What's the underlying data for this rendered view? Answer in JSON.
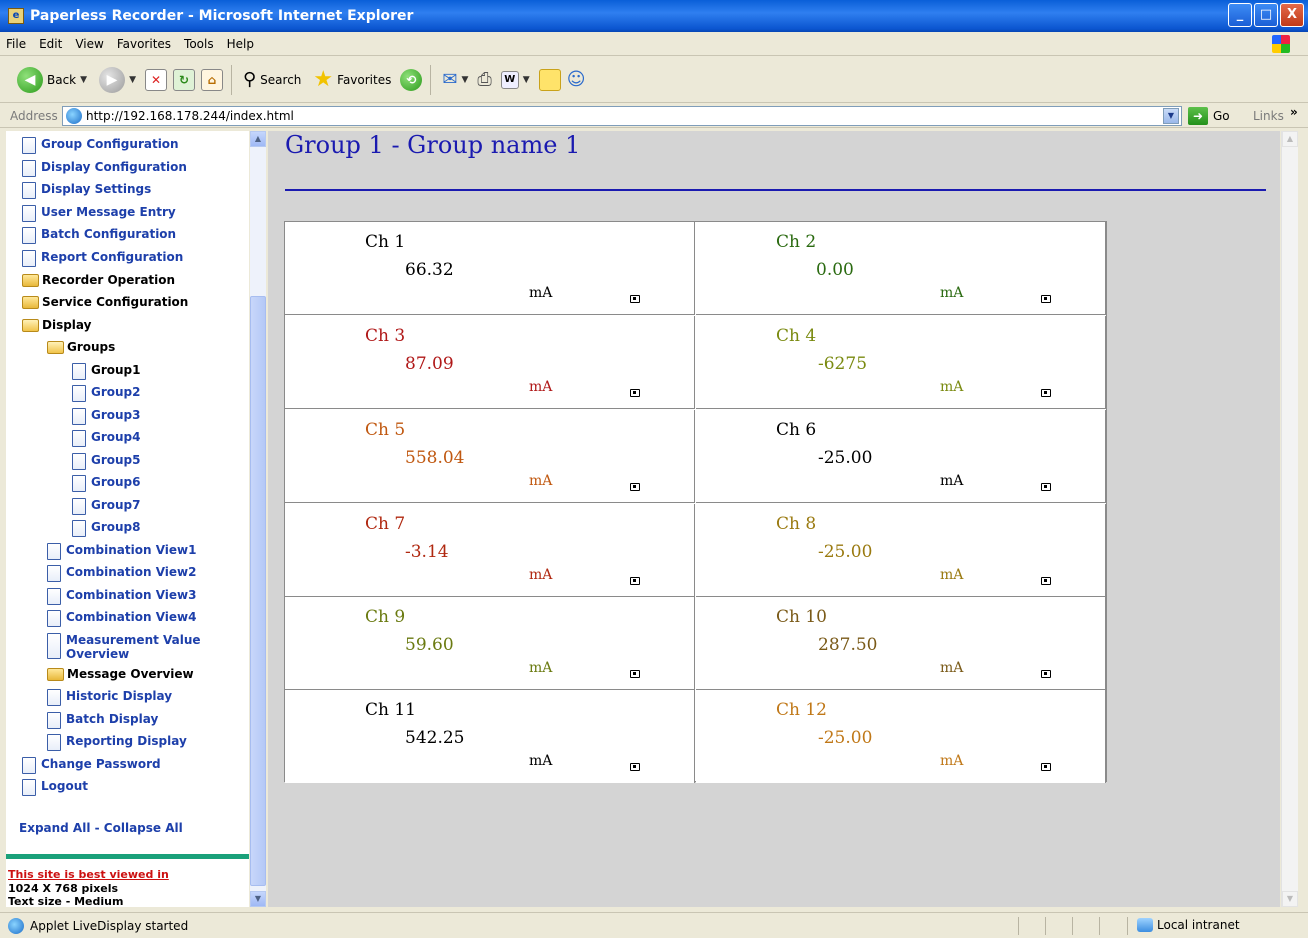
{
  "window": {
    "title": "Paperless Recorder - Microsoft Internet Explorer",
    "buttons": [
      "_",
      "□",
      "X"
    ]
  },
  "menu": [
    "File",
    "Edit",
    "View",
    "Favorites",
    "Tools",
    "Help"
  ],
  "toolbar": {
    "back_label": "Back",
    "search_label": "Search",
    "favorites_label": "Favorites"
  },
  "address": {
    "label": "Address",
    "url": "http://192.168.178.244/index.html",
    "go_label": "Go",
    "links_label": "Links"
  },
  "nav": {
    "items": [
      {
        "label": "Group Configuration",
        "type": "doc"
      },
      {
        "label": "Display Configuration",
        "type": "doc"
      },
      {
        "label": "Display Settings",
        "type": "doc"
      },
      {
        "label": "User Message Entry",
        "type": "doc"
      },
      {
        "label": "Batch Configuration",
        "type": "doc"
      },
      {
        "label": "Report Configuration",
        "type": "doc"
      },
      {
        "label": "Recorder Operation",
        "type": "folder"
      },
      {
        "label": "Service Configuration",
        "type": "folder"
      },
      {
        "label": "Display",
        "type": "folder-open"
      },
      {
        "label": "Groups",
        "type": "folder-open"
      },
      {
        "label": "Group1",
        "type": "doc"
      },
      {
        "label": "Group2",
        "type": "doc"
      },
      {
        "label": "Group3",
        "type": "doc"
      },
      {
        "label": "Group4",
        "type": "doc"
      },
      {
        "label": "Group5",
        "type": "doc"
      },
      {
        "label": "Group6",
        "type": "doc"
      },
      {
        "label": "Group7",
        "type": "doc"
      },
      {
        "label": "Group8",
        "type": "doc"
      },
      {
        "label": "Combination View1",
        "type": "doc"
      },
      {
        "label": "Combination View2",
        "type": "doc"
      },
      {
        "label": "Combination View3",
        "type": "doc"
      },
      {
        "label": "Combination View4",
        "type": "doc"
      },
      {
        "label": "Measurement Value Overview",
        "type": "doc"
      },
      {
        "label": "Message Overview",
        "type": "folder"
      },
      {
        "label": "Historic Display",
        "type": "doc"
      },
      {
        "label": "Batch Display",
        "type": "doc"
      },
      {
        "label": "Reporting Display",
        "type": "doc"
      },
      {
        "label": "Change Password",
        "type": "doc"
      },
      {
        "label": "Logout",
        "type": "doc"
      }
    ],
    "expand_collapse": "Expand All - Collapse All",
    "best_viewed": "This site is best viewed in",
    "resolution": "1024 X 768 pixels",
    "text_size": "Text size - Medium"
  },
  "main": {
    "title": "Group 1 - Group name 1",
    "channels": [
      {
        "name": "Ch 1",
        "value": "66.32",
        "unit": "mA",
        "color": "#000000"
      },
      {
        "name": "Ch 2",
        "value": "0.00",
        "unit": "mA",
        "color": "#2a6a10"
      },
      {
        "name": "Ch 3",
        "value": "87.09",
        "unit": "mA",
        "color": "#b01818"
      },
      {
        "name": "Ch 4",
        "value": "-6275",
        "unit": "mA",
        "color": "#7a8a10"
      },
      {
        "name": "Ch 5",
        "value": "558.04",
        "unit": "mA",
        "color": "#c05810"
      },
      {
        "name": "Ch 6",
        "value": "-25.00",
        "unit": "mA",
        "color": "#000000"
      },
      {
        "name": "Ch 7",
        "value": "-3.14",
        "unit": "mA",
        "color": "#b02810"
      },
      {
        "name": "Ch 8",
        "value": "-25.00",
        "unit": "mA",
        "color": "#9a7a10"
      },
      {
        "name": "Ch 9",
        "value": "59.60",
        "unit": "mA",
        "color": "#6a7a10"
      },
      {
        "name": "Ch 10",
        "value": "287.50",
        "unit": "mA",
        "color": "#7a5a18"
      },
      {
        "name": "Ch 11",
        "value": "542.25",
        "unit": "mA",
        "color": "#000000"
      },
      {
        "name": "Ch 12",
        "value": "-25.00",
        "unit": "mA",
        "color": "#c07818"
      }
    ]
  },
  "status": {
    "text": "Applet LiveDisplay started",
    "zone": "Local intranet"
  }
}
